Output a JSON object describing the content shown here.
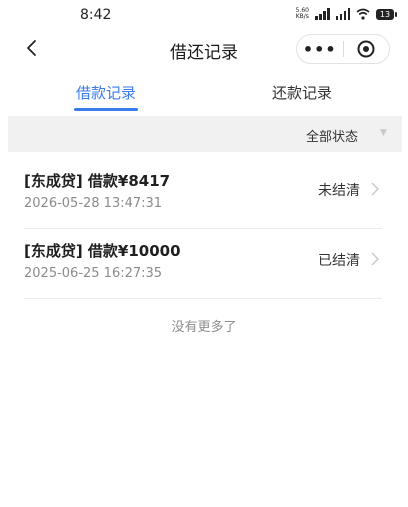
{
  "status_bar": {
    "time": "8:42",
    "net_speed_value": "5.60",
    "net_speed_unit": "KB/s",
    "battery": "13"
  },
  "nav": {
    "title": "借还记录",
    "more_label": "•••"
  },
  "tabs": [
    {
      "label": "借款记录",
      "active": true
    },
    {
      "label": "还款记录",
      "active": false
    }
  ],
  "filter": {
    "label": "全部状态"
  },
  "records": [
    {
      "title": "[东成贷] 借款¥8417",
      "time": "2026-05-28 13:47:31",
      "status": "未结清"
    },
    {
      "title": "[东成贷] 借款¥10000",
      "time": "2025-06-25 16:27:35",
      "status": "已结清"
    }
  ],
  "footer_text": "没有更多了",
  "colors": {
    "accent": "#3a7bf0",
    "filter_bg": "#f1f1f1",
    "muted_text": "#8b8b8b"
  }
}
